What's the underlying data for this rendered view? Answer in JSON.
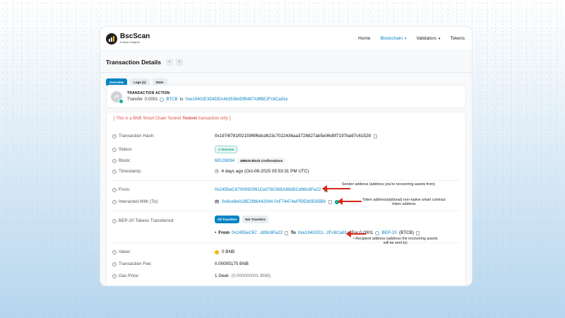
{
  "brand": {
    "name": "BscScan",
    "tagline": "A Scan Original"
  },
  "nav": {
    "home": "Home",
    "blockchain": "Blockchain",
    "validators": "Validators",
    "tokens": "Tokens"
  },
  "page": {
    "title": "Transaction Details",
    "prev": "‹",
    "next": "›"
  },
  "tabs": [
    "Overview",
    "Logs (1)",
    "State"
  ],
  "action": {
    "heading": "TRANSACTION ACTION",
    "prefix": "Transfer",
    "amount": "0.0001",
    "token": "BTCB",
    "to_word": "to",
    "to_address": "0xe19402E3D4DEA4b3536dDfB487A9fBE2Fc6Ca81e"
  },
  "notice": {
    "pre": "[ This is a BNB Smart Chain Testnet ",
    "bold": "Testnet",
    "post": " transaction only ]"
  },
  "rows": {
    "hash_label": "Transaction Hash:",
    "hash": "0x1974f781f02159f6f6dcd623c7022436aa3728827ab5e06d9f7197ba97c61528",
    "status_label": "Status:",
    "status": "Success",
    "block_label": "Block:",
    "block": "68133834",
    "confirmations": "488615 Block Confirmations",
    "timestamp_label": "Timestamp:",
    "timestamp": "4 days ago (Oct-08-2025 05:53:31 PM UTC)",
    "from_label": "From:",
    "from": "0x2455eC6700092991Ce0782365A89d5Cd89c8Fa22",
    "to_label": "Interacted With (To):",
    "to": "0x6ce8dA28E2f86442084 0cF74474eFf5fD80E65B8",
    "tokens_label": "BEP-20 Tokens Transferred:",
    "all_transfers": "All Transfers",
    "net_transfers": "Net Transfers",
    "transfer_from_word": "From",
    "transfer_from": "0x2455eC67...d89c8Fa22",
    "transfer_to_word": "To",
    "transfer_to": "0xe19402E3...2Fc6Ca81e",
    "transfer_for": "For 0.0001",
    "transfer_token": "BEP-20",
    "transfer_symbol": "(BTCB)",
    "value_label": "Value:",
    "value": "0 BNB",
    "fee_label": "Transaction Fee:",
    "fee": "0.00005175 BNB",
    "gas_label": "Gas Price:",
    "gas": "1 Gwei",
    "gas_bnb": "(0.000000001 BNB)"
  },
  "annotations": {
    "sender": "Sender address (address you're recovering assets from)",
    "token_line1": "Token address(optional) non-native smart contract",
    "token_line2": "token address",
    "recipient_line1": "• Recipient address (address the recovering assets",
    "recipient_line2": "will be sent to)"
  },
  "colors": {
    "accent": "#0784c3",
    "arrow": "#d62718",
    "success": "#00a186",
    "warning": "#d9534f"
  }
}
